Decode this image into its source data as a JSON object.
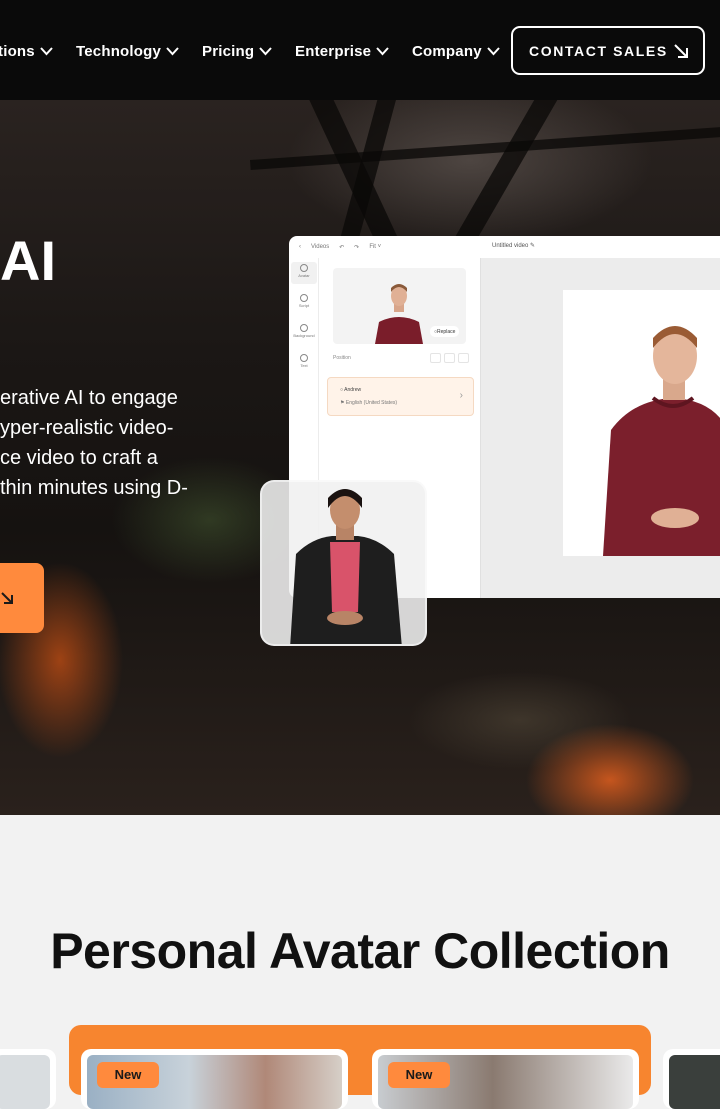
{
  "nav": {
    "items": [
      {
        "label": "tions"
      },
      {
        "label": "Technology"
      },
      {
        "label": "Pricing"
      },
      {
        "label": "Enterprise"
      },
      {
        "label": "Company"
      }
    ],
    "contact_label": "CONTACT SALES"
  },
  "hero": {
    "title": "AI",
    "text_lines": [
      "erative AI to engage",
      "yper-realistic video-",
      "ce video to craft a",
      "thin minutes using D-"
    ]
  },
  "editor": {
    "back_label": "Videos",
    "fit_label": "Fit",
    "doc_title": "Untitled video",
    "rail": [
      "Avatar",
      "Script",
      "Background",
      "Text"
    ],
    "replace_label": "Replace",
    "position_label": "Position",
    "voice_name": "Andrew",
    "voice_lang": "English (United States)"
  },
  "collection": {
    "title": "Personal Avatar Collection",
    "badges": [
      "New",
      "New"
    ]
  },
  "colors": {
    "accent": "#ff8a3d",
    "nav_bg": "#0a0a0a",
    "panel": "#f7852f"
  }
}
